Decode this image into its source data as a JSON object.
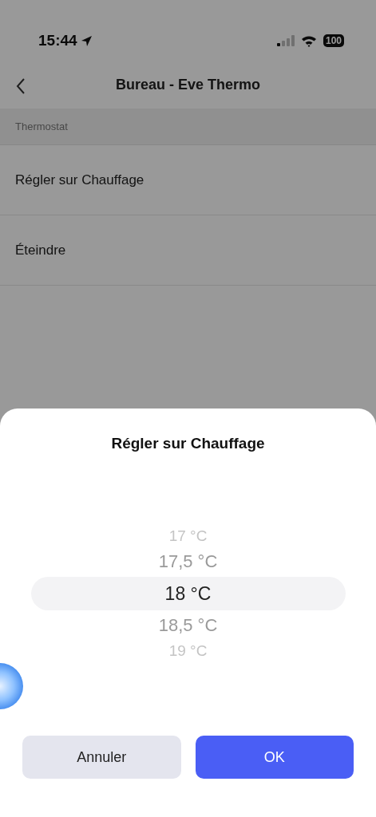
{
  "status_bar": {
    "time": "15:44",
    "battery": "100"
  },
  "header": {
    "title": "Bureau - Eve Thermo"
  },
  "section": {
    "title": "Thermostat"
  },
  "rows": [
    {
      "label": "Régler sur Chauffage"
    },
    {
      "label": "Éteindre"
    }
  ],
  "sheet": {
    "title": "Régler sur Chauffage",
    "picker": [
      {
        "label": "17 °C",
        "selected": false
      },
      {
        "label": "17,5 °C",
        "selected": false
      },
      {
        "label": "18 °C",
        "selected": true
      },
      {
        "label": "18,5 °C",
        "selected": false
      },
      {
        "label": "19 °C",
        "selected": false
      }
    ],
    "buttons": [
      {
        "label": "Annuler",
        "kind": "secondary"
      },
      {
        "label": "OK",
        "kind": "primary"
      }
    ]
  }
}
